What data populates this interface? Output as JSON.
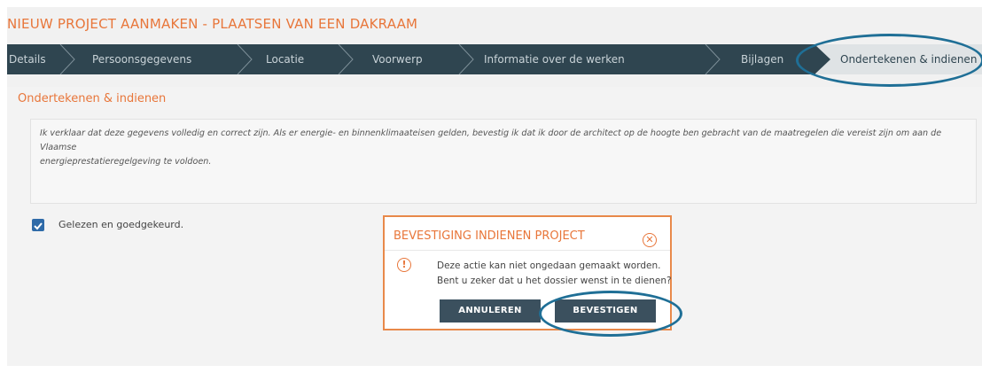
{
  "page": {
    "title": "NIEUW PROJECT AANMAKEN - PLAATSEN VAN EEN DAKRAAM"
  },
  "steps": [
    {
      "label": "Details"
    },
    {
      "label": "Persoonsgegevens"
    },
    {
      "label": "Locatie"
    },
    {
      "label": "Voorwerp"
    },
    {
      "label": "Informatie over de werken"
    },
    {
      "label": "Bijlagen"
    },
    {
      "label": "Ondertekenen & indienen",
      "active": true
    }
  ],
  "panel": {
    "title": "Ondertekenen & indienen",
    "declaration_line1": "Ik verklaar dat deze gegevens volledig en correct zijn. Als er energie- en binnenklimaateisen gelden, bevestig ik dat ik door de architect op de hoogte ben gebracht van de maatregelen die vereist zijn om aan de Vlaamse",
    "declaration_line2": "energieprestatieregelgeving te voldoen.",
    "checkbox_label": "Gelezen en goedgekeurd.",
    "checkbox_checked": true
  },
  "modal": {
    "title": "BEVESTIGING INDIENEN PROJECT",
    "close_icon": "close-circle-icon",
    "warning_icon": "exclamation-circle-icon",
    "message_line1": "Deze actie kan niet ongedaan gemaakt worden.",
    "message_line2": "Bent u zeker dat u het dossier wenst in te dienen?",
    "cancel_label": "ANNULEREN",
    "confirm_label": "BEVESTIGEN"
  },
  "colors": {
    "accent": "#e8763a",
    "stepbar": "#2f4550",
    "button": "#3b505e",
    "annotation": "#1f6f96"
  }
}
